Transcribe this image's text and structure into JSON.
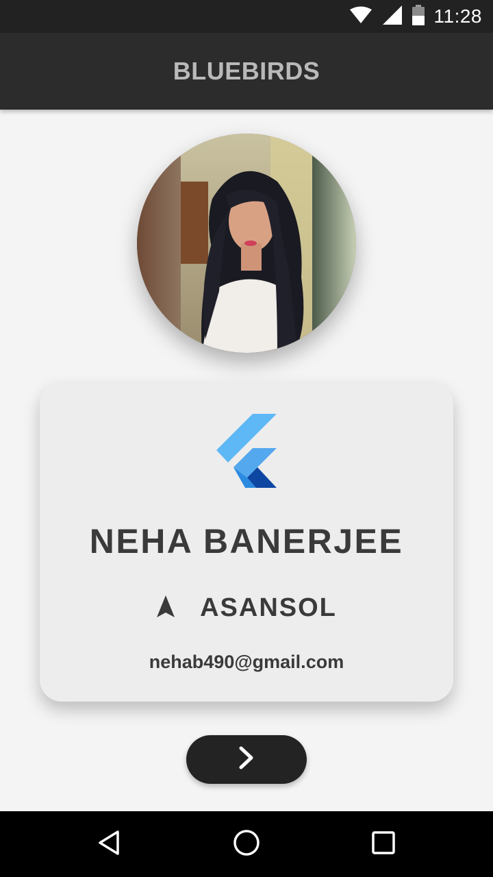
{
  "status_bar": {
    "time": "11:28",
    "icons": [
      "wifi-icon",
      "signal-icon",
      "battery-icon"
    ]
  },
  "app_bar": {
    "title": "BLUEBIRDS"
  },
  "profile": {
    "avatar": "profile-photo",
    "logo": "flutter-logo-icon",
    "name": "NEHA BANERJEE",
    "location_icon": "navigation-arrow-icon",
    "location": "ASANSOL",
    "email": "nehab490@gmail.com"
  },
  "next_button": {
    "icon": "chevron-right-icon"
  },
  "nav_bar": {
    "buttons": [
      "back-triangle-icon",
      "home-circle-icon",
      "recents-square-icon"
    ]
  },
  "colors": {
    "status_bar": "#222222",
    "app_bar": "#2c2c2c",
    "title_text": "#b9b9b9",
    "page_background": "#f4f4f4",
    "card_background": "#ededed",
    "text": "#3a3a3a",
    "button": "#232323",
    "flutter_light_blue": "#54c5f8",
    "flutter_blue": "#29b6f6",
    "flutter_dark_blue": "#01579b"
  }
}
